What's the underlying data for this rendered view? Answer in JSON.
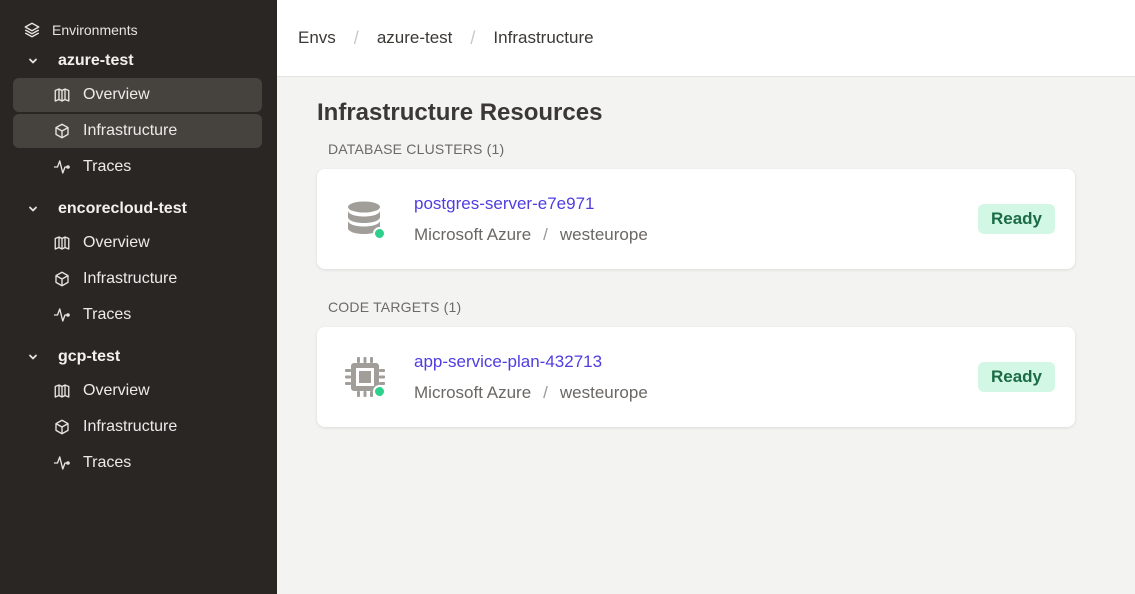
{
  "sidebar": {
    "header": {
      "label": "Environments",
      "icon": "layers-icon"
    },
    "environments": [
      {
        "name": "azure-test",
        "items": [
          {
            "label": "Overview",
            "icon": "map-icon",
            "active": true
          },
          {
            "label": "Infrastructure",
            "icon": "cube-icon",
            "active": true
          },
          {
            "label": "Traces",
            "icon": "activity-icon",
            "active": false
          }
        ]
      },
      {
        "name": "encorecloud-test",
        "items": [
          {
            "label": "Overview",
            "icon": "map-icon",
            "active": false
          },
          {
            "label": "Infrastructure",
            "icon": "cube-icon",
            "active": false
          },
          {
            "label": "Traces",
            "icon": "activity-icon",
            "active": false
          }
        ]
      },
      {
        "name": "gcp-test",
        "items": [
          {
            "label": "Overview",
            "icon": "map-icon",
            "active": false
          },
          {
            "label": "Infrastructure",
            "icon": "cube-icon",
            "active": false
          },
          {
            "label": "Traces",
            "icon": "activity-icon",
            "active": false
          }
        ]
      }
    ]
  },
  "breadcrumb": {
    "items": [
      "Envs",
      "azure-test",
      "Infrastructure"
    ],
    "separator": "/"
  },
  "main": {
    "title": "Infrastructure Resources",
    "sections": [
      {
        "label": "DATABASE CLUSTERS (1)",
        "resources": [
          {
            "name": "postgres-server-e7e971",
            "provider": "Microsoft Azure",
            "region": "westeurope",
            "separator": "/",
            "status": "Ready",
            "icon": "database-icon"
          }
        ]
      },
      {
        "label": "CODE TARGETS (1)",
        "resources": [
          {
            "name": "app-service-plan-432713",
            "provider": "Microsoft Azure",
            "region": "westeurope",
            "separator": "/",
            "status": "Ready",
            "icon": "cpu-icon"
          }
        ]
      }
    ]
  },
  "colors": {
    "sidebar_bg": "#2a2624",
    "active_item_bg": "#46423e",
    "link": "#4e3de0",
    "status_ok": "#2fcf8c",
    "badge_bg": "#d2f7e4",
    "badge_text": "#1a6b46"
  }
}
